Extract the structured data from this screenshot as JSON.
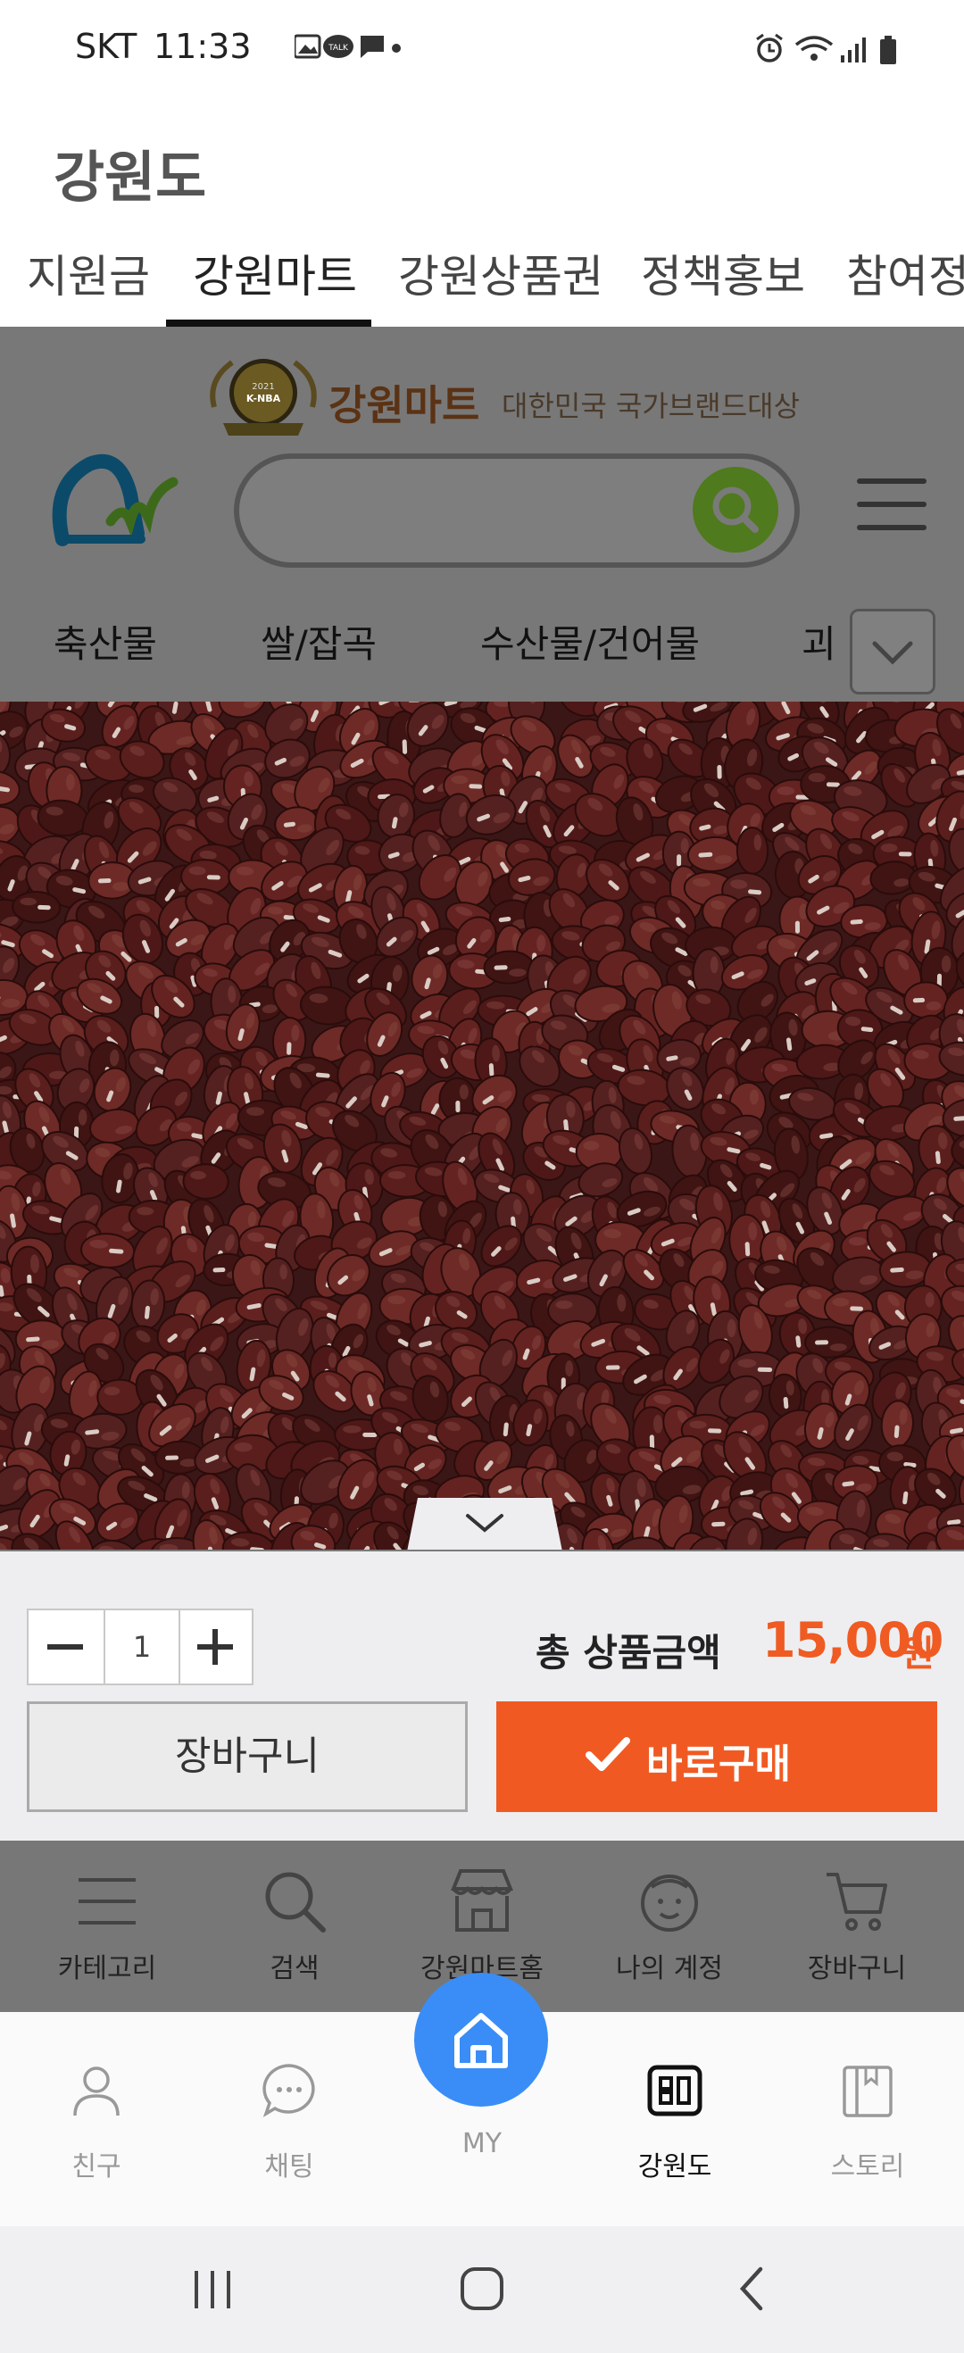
{
  "status_bar": {
    "carrier": "SKT",
    "time": "11:33"
  },
  "app": {
    "title": "강원도",
    "tabs": [
      {
        "label": "지원금"
      },
      {
        "label": "강원마트",
        "active": true
      },
      {
        "label": "강원상품권"
      },
      {
        "label": "정책홍보"
      },
      {
        "label": "참여정"
      }
    ]
  },
  "site": {
    "banner_title": "강원마트",
    "banner_subtitle": "대한민국 국가브랜드대상",
    "award_badge": "2021 K-NBA",
    "search": {
      "placeholder": ""
    },
    "categories": [
      "축산물",
      "쌀/잡곡",
      "수산물/건어물",
      "괴"
    ]
  },
  "purchase": {
    "quantity": "1",
    "total_label": "총 상품금액",
    "price": "15,000",
    "currency": "원",
    "cart_label": "장바구니",
    "buy_label": "바로구매",
    "accent_color": "#f05a22"
  },
  "site_nav": [
    {
      "label": "카테고리",
      "icon": "menu-icon"
    },
    {
      "label": "검색",
      "icon": "search-icon"
    },
    {
      "label": "강원마트홈",
      "icon": "store-icon"
    },
    {
      "label": "나의 계정",
      "icon": "face-icon"
    },
    {
      "label": "장바구니",
      "icon": "cart-icon"
    }
  ],
  "app_nav": [
    {
      "label": "친구",
      "icon": "person-icon"
    },
    {
      "label": "채팅",
      "icon": "chat-icon"
    },
    {
      "label": "MY",
      "icon": "home-icon"
    },
    {
      "label": "강원도",
      "icon": "grid-icon",
      "active": true
    },
    {
      "label": "스토리",
      "icon": "book-icon"
    }
  ]
}
